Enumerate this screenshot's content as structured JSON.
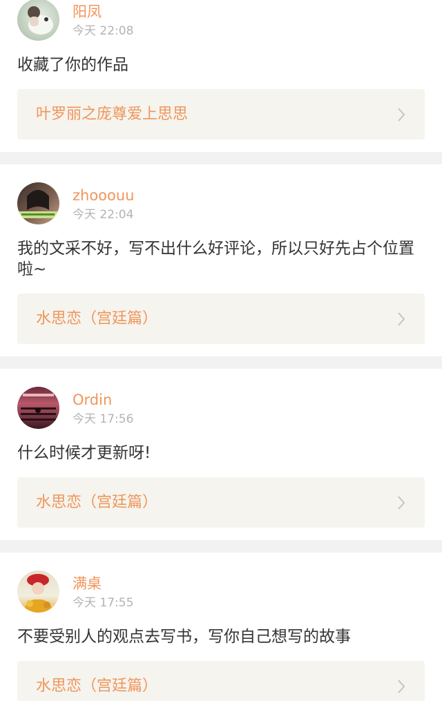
{
  "feed": [
    {
      "user": "阳凤",
      "time": "今天 22:08",
      "comment": "收藏了你的作品",
      "work_title": "叶罗丽之庞尊爱上思思",
      "avatar_icon": "avatar-white-dog-icon"
    },
    {
      "user": "zhooouu",
      "time": "今天 22:04",
      "comment": "我的文采不好，写不出什么好评论，所以只好先占个位置啦~",
      "work_title": "水思恋（宫廷篇）",
      "avatar_icon": "avatar-girl-portrait-icon"
    },
    {
      "user": "Ordin",
      "time": "今天 17:56",
      "comment": "什么时候才更新呀!",
      "work_title": "水思恋（宫廷篇）",
      "avatar_icon": "avatar-church-interior-icon"
    },
    {
      "user": "满桌",
      "time": "今天 17:55",
      "comment": "不要受别人的观点去写书，写你自己想写的故事",
      "work_title": "水思恋（宫廷篇）",
      "avatar_icon": "avatar-girl-red-hat-icon"
    }
  ],
  "colors": {
    "accent": "#f0955a",
    "time": "#b3b3b3",
    "text": "#333333",
    "link_bg": "#f5f4ee",
    "separator": "#f2f2f2"
  }
}
